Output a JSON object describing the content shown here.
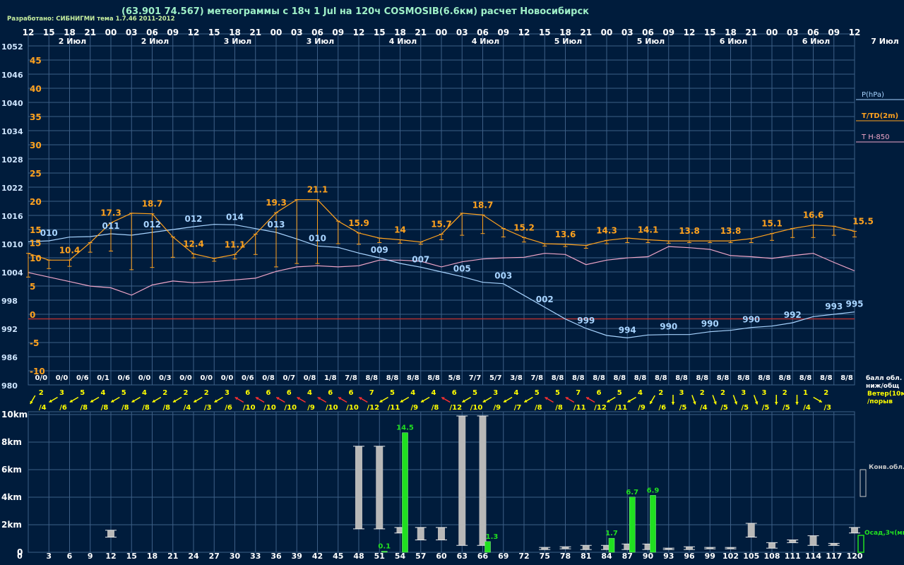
{
  "header": {
    "title": "(63.901 74.567) метеограммы с  18ч 1 Jul на 120ч COSMOSIB(6.6км) расчет Новосибирск",
    "credit": "Разработано: СИБНИГМИ тема 1.7.46 2011-2012"
  },
  "time_axis": {
    "hours": [
      "12",
      "15",
      "18",
      "21",
      "00",
      "03",
      "06",
      "09",
      "12",
      "15",
      "18",
      "21",
      "00",
      "03",
      "06",
      "09",
      "12",
      "15",
      "18",
      "21",
      "00",
      "03",
      "06",
      "09",
      "12",
      "15",
      "18",
      "21",
      "00",
      "03",
      "06",
      "09",
      "12",
      "15",
      "18",
      "21",
      "00",
      "03",
      "06",
      "09",
      "12"
    ],
    "dates": [
      "2 Июл",
      "2 Июл",
      "3 Июл",
      "3 Июл",
      "4 Июл",
      "4 Июл",
      "5 Июл",
      "5 Июл",
      "6 Июл",
      "6 Июл",
      "7 Июл"
    ],
    "lead_hours": [
      "0",
      "3",
      "6",
      "9",
      "12",
      "15",
      "18",
      "21",
      "24",
      "27",
      "30",
      "33",
      "36",
      "39",
      "42",
      "45",
      "48",
      "51",
      "54",
      "57",
      "60",
      "63",
      "66",
      "69",
      "72",
      "75",
      "78",
      "81",
      "84",
      "87",
      "90",
      "93",
      "96",
      "99",
      "102",
      "105",
      "108",
      "111",
      "114",
      "117",
      "120"
    ]
  },
  "axes": {
    "pressure_ticks": [
      "1052",
      "1046",
      "1040",
      "1034",
      "1028",
      "1022",
      "1016",
      "1010",
      "1004",
      "998",
      "992",
      "986",
      "980"
    ],
    "temp_ticks": [
      "45",
      "40",
      "35",
      "30",
      "25",
      "20",
      "15",
      "10",
      "5",
      "0",
      "-5",
      "-10"
    ],
    "height_ticks": [
      "10km",
      "8km",
      "6km",
      "4km",
      "2km",
      "0"
    ]
  },
  "legend": {
    "pressure": "P(hPa)",
    "temperature": "T/TD(2m)",
    "t850": "T H-850",
    "cloud": "балл обл.\nниж/общ",
    "wind": "Ветер(10м)\n/порыв",
    "conv": "Конв.обл.",
    "precip": "Осад,3ч(мм)"
  },
  "colors": {
    "background": "#001c3c",
    "grid": "#3d5f86",
    "pressure": "#a8d4ff",
    "temperature": "#ffa21e",
    "t850": "#f0a6c8",
    "zero_line": "#b03030",
    "wind_normal": "#ffff00",
    "wind_strong": "#ff3030",
    "precip": "#20e020",
    "conv_cloud": "#b8b8b8"
  },
  "chart_data": {
    "type": "line",
    "x_hours": [
      0,
      3,
      6,
      9,
      12,
      15,
      18,
      21,
      24,
      27,
      30,
      33,
      36,
      39,
      42,
      45,
      48,
      51,
      54,
      57,
      60,
      63,
      66,
      69,
      72,
      75,
      78,
      81,
      84,
      87,
      90,
      93,
      96,
      99,
      102,
      105,
      108,
      111,
      114,
      117,
      120
    ],
    "pressure": [
      1010.4,
      1010.6,
      1011.4,
      1011.5,
      1012.1,
      1011.8,
      1012.4,
      1013.0,
      1013.6,
      1014.1,
      1014.0,
      1013.2,
      1012.4,
      1011.0,
      1009.5,
      1009.2,
      1008.0,
      1007.0,
      1005.8,
      1005.0,
      1004.0,
      1003.0,
      1001.8,
      1001.5,
      999.0,
      996.5,
      994.0,
      992.0,
      990.5,
      990.0,
      990.6,
      990.7,
      990.7,
      991.3,
      991.6,
      992.2,
      992.5,
      993.2,
      994.5,
      995.0,
      995.5
    ],
    "pressure_labels": [
      {
        "i": 1,
        "t": "010"
      },
      {
        "i": 4,
        "t": "011"
      },
      {
        "i": 6,
        "t": "012"
      },
      {
        "i": 8,
        "t": "012"
      },
      {
        "i": 10,
        "t": "014"
      },
      {
        "i": 12,
        "t": "013"
      },
      {
        "i": 14,
        "t": "010"
      },
      {
        "i": 17,
        "t": "009"
      },
      {
        "i": 19,
        "t": "007"
      },
      {
        "i": 21,
        "t": "005"
      },
      {
        "i": 23,
        "t": "003"
      },
      {
        "i": 25,
        "t": "002"
      },
      {
        "i": 27,
        "t": "999"
      },
      {
        "i": 29,
        "t": "994"
      },
      {
        "i": 31,
        "t": "990"
      },
      {
        "i": 33,
        "t": "990"
      },
      {
        "i": 35,
        "t": "990"
      },
      {
        "i": 37,
        "t": "992"
      },
      {
        "i": 39,
        "t": "993"
      },
      {
        "i": 40,
        "t": "995"
      }
    ],
    "temperature": [
      11.6,
      10.4,
      10.4,
      13.5,
      17.0,
      18.7,
      18.6,
      14.5,
      11.5,
      10.7,
      11.4,
      15.0,
      18.8,
      21.1,
      21.1,
      17.3,
      15.2,
      14.3,
      14.0,
      13.6,
      15.0,
      18.7,
      18.4,
      16.0,
      14.4,
      13.3,
      13.2,
      13.0,
      13.9,
      14.3,
      14.0,
      13.8,
      13.8,
      13.8,
      13.8,
      14.2,
      15.1,
      16.0,
      16.6,
      16.4,
      15.5
    ],
    "temperature_labels": [
      {
        "i": 0,
        "t": "15"
      },
      {
        "i": 2,
        "t": "10.4"
      },
      {
        "i": 4,
        "t": "17.3"
      },
      {
        "i": 6,
        "t": "18.7"
      },
      {
        "i": 8,
        "t": "12.4"
      },
      {
        "i": 10,
        "t": "11.1"
      },
      {
        "i": 12,
        "t": "19.3"
      },
      {
        "i": 14,
        "t": "21.1"
      },
      {
        "i": 16,
        "t": "15.9"
      },
      {
        "i": 18,
        "t": "14"
      },
      {
        "i": 20,
        "t": "15.7"
      },
      {
        "i": 22,
        "t": "18.7"
      },
      {
        "i": 24,
        "t": "15.2"
      },
      {
        "i": 26,
        "t": "13.6"
      },
      {
        "i": 28,
        "t": "14.3"
      },
      {
        "i": 30,
        "t": "14.1"
      },
      {
        "i": 32,
        "t": "13.8"
      },
      {
        "i": 34,
        "t": "13.8"
      },
      {
        "i": 36,
        "t": "15.1"
      },
      {
        "i": 38,
        "t": "16.6"
      },
      {
        "i": 40,
        "t": "15.5"
      }
    ],
    "dewpoint_drop": [
      4.2,
      1.5,
      1.1,
      1.7,
      5.0,
      10.0,
      9.5,
      3.6,
      0.7,
      0.5,
      0.8,
      3.6,
      9.6,
      11.3,
      11.3,
      4.0,
      2.0,
      0.8,
      0.6,
      0.4,
      1.0,
      3.9,
      3.3,
      1.5,
      0.8,
      0.4,
      0.4,
      0.5,
      0.6,
      0.8,
      0.5,
      0.4,
      0.3,
      0.3,
      0.3,
      0.7,
      1.2,
      1.6,
      2.2,
      1.6,
      1.0
    ],
    "t850": [
      8.2,
      7.4,
      6.6,
      5.8,
      5.5,
      4.2,
      6.0,
      6.7,
      6.4,
      6.6,
      6.9,
      7.2,
      8.4,
      9.2,
      9.4,
      9.2,
      9.4,
      10.4,
      10.4,
      10.2,
      9.2,
      10.1,
      10.6,
      10.8,
      10.9,
      11.6,
      11.4,
      9.6,
      10.4,
      10.8,
      11.0,
      12.8,
      12.6,
      12.3,
      11.2,
      11.0,
      10.7,
      11.2,
      11.6,
      10.0,
      8.5
    ],
    "cloud": [
      "0/0",
      "0/0",
      "0/6",
      "0/1",
      "0/6",
      "0/0",
      "0/3",
      "0/0",
      "0/0",
      "0/0",
      "0/6",
      "0/8",
      "0/7",
      "0/8",
      "1/8",
      "7/8",
      "8/8",
      "8/8",
      "8/8",
      "8/8",
      "5/8",
      "7/7",
      "5/7",
      "3/8",
      "7/8",
      "8/8",
      "8/8",
      "8/8",
      "8/8",
      "8/8",
      "8/8",
      "8/8",
      "8/8",
      "8/8",
      "8/8",
      "8/8",
      "8/8",
      "8/8",
      "8/8",
      "8/8"
    ],
    "wind_speed": [
      "2",
      "3",
      "5",
      "4",
      "5",
      "4",
      "2",
      "2",
      "2",
      "3",
      "6",
      "6",
      "6",
      "4",
      "6",
      "6",
      "7",
      "5",
      "4",
      "4",
      "6",
      "5",
      "3",
      "4",
      "5",
      "5",
      "7",
      "6",
      "5",
      "4",
      "2",
      "3",
      "2",
      "2",
      "3",
      "3",
      "2",
      "1",
      "2"
    ],
    "wind_gust": [
      "/4",
      "/6",
      "/8",
      "/8",
      "/8",
      "/8",
      "/8",
      "/4",
      "/3",
      "/6",
      "/10",
      "/10",
      "/10",
      "/9",
      "/10",
      "/10",
      "/12",
      "/11",
      "/9",
      "/8",
      "/12",
      "/10",
      "/9",
      "/7",
      "/8",
      "/8",
      "/11",
      "/12",
      "/11",
      "/9",
      "/6",
      "/5",
      "/4",
      "/5",
      "/5",
      "/5",
      "/5",
      "/4",
      "/3"
    ],
    "wind_dir": [
      30,
      60,
      60,
      60,
      60,
      60,
      60,
      60,
      60,
      60,
      120,
      120,
      120,
      120,
      120,
      120,
      120,
      60,
      60,
      60,
      120,
      60,
      60,
      60,
      60,
      120,
      120,
      120,
      60,
      60,
      30,
      0,
      340,
      340,
      340,
      340,
      0,
      0,
      300
    ],
    "wind_strong": [
      false,
      false,
      false,
      false,
      false,
      false,
      false,
      false,
      false,
      false,
      true,
      true,
      true,
      true,
      true,
      true,
      true,
      false,
      false,
      false,
      true,
      false,
      false,
      false,
      false,
      true,
      true,
      true,
      false,
      false,
      false,
      false,
      false,
      false,
      false,
      false,
      false,
      false,
      false
    ],
    "precip": [
      {
        "h": 51,
        "v": 0.1,
        "label": "0.1"
      },
      {
        "h": 54,
        "v": 14.5,
        "label": "14.5"
      },
      {
        "h": 66,
        "v": 1.3,
        "label": "1.3"
      },
      {
        "h": 84,
        "v": 1.7,
        "label": "1.7"
      },
      {
        "h": 87,
        "v": 6.7,
        "label": "6.7"
      },
      {
        "h": 90,
        "v": 6.9,
        "label": "6.9"
      }
    ],
    "conv_cloud": [
      {
        "h": 12,
        "b": 1.1,
        "t": 1.6
      },
      {
        "h": 48,
        "b": 1.7,
        "t": 7.7
      },
      {
        "h": 51,
        "b": 1.7,
        "t": 7.7
      },
      {
        "h": 54,
        "b": 1.4,
        "t": 1.8
      },
      {
        "h": 57,
        "b": 0.9,
        "t": 1.8
      },
      {
        "h": 60,
        "b": 0.9,
        "t": 1.8
      },
      {
        "h": 63,
        "b": 0.5,
        "t": 9.9
      },
      {
        "h": 66,
        "b": 0.5,
        "t": 9.9
      },
      {
        "h": 75,
        "b": 0.2,
        "t": 0.35
      },
      {
        "h": 78,
        "b": 0.25,
        "t": 0.4
      },
      {
        "h": 81,
        "b": 0.2,
        "t": 0.5
      },
      {
        "h": 84,
        "b": 0.2,
        "t": 0.5
      },
      {
        "h": 87,
        "b": 0.2,
        "t": 0.6
      },
      {
        "h": 90,
        "b": 0.2,
        "t": 0.6
      },
      {
        "h": 93,
        "b": 0.2,
        "t": 0.3
      },
      {
        "h": 96,
        "b": 0.2,
        "t": 0.4
      },
      {
        "h": 99,
        "b": 0.25,
        "t": 0.35
      },
      {
        "h": 102,
        "b": 0.25,
        "t": 0.35
      },
      {
        "h": 105,
        "b": 1.1,
        "t": 2.1
      },
      {
        "h": 108,
        "b": 0.3,
        "t": 0.7
      },
      {
        "h": 111,
        "b": 0.7,
        "t": 0.9
      },
      {
        "h": 114,
        "b": 0.5,
        "t": 1.2
      },
      {
        "h": 117,
        "b": 0.5,
        "t": 0.65
      },
      {
        "h": 120,
        "b": 1.4,
        "t": 1.8
      }
    ],
    "pressure_range": [
      980,
      1052
    ],
    "temp_range": [
      -13,
      48
    ],
    "height_range_km": [
      0,
      10
    ],
    "precip_scale_mm_per_km": 1.67
  }
}
